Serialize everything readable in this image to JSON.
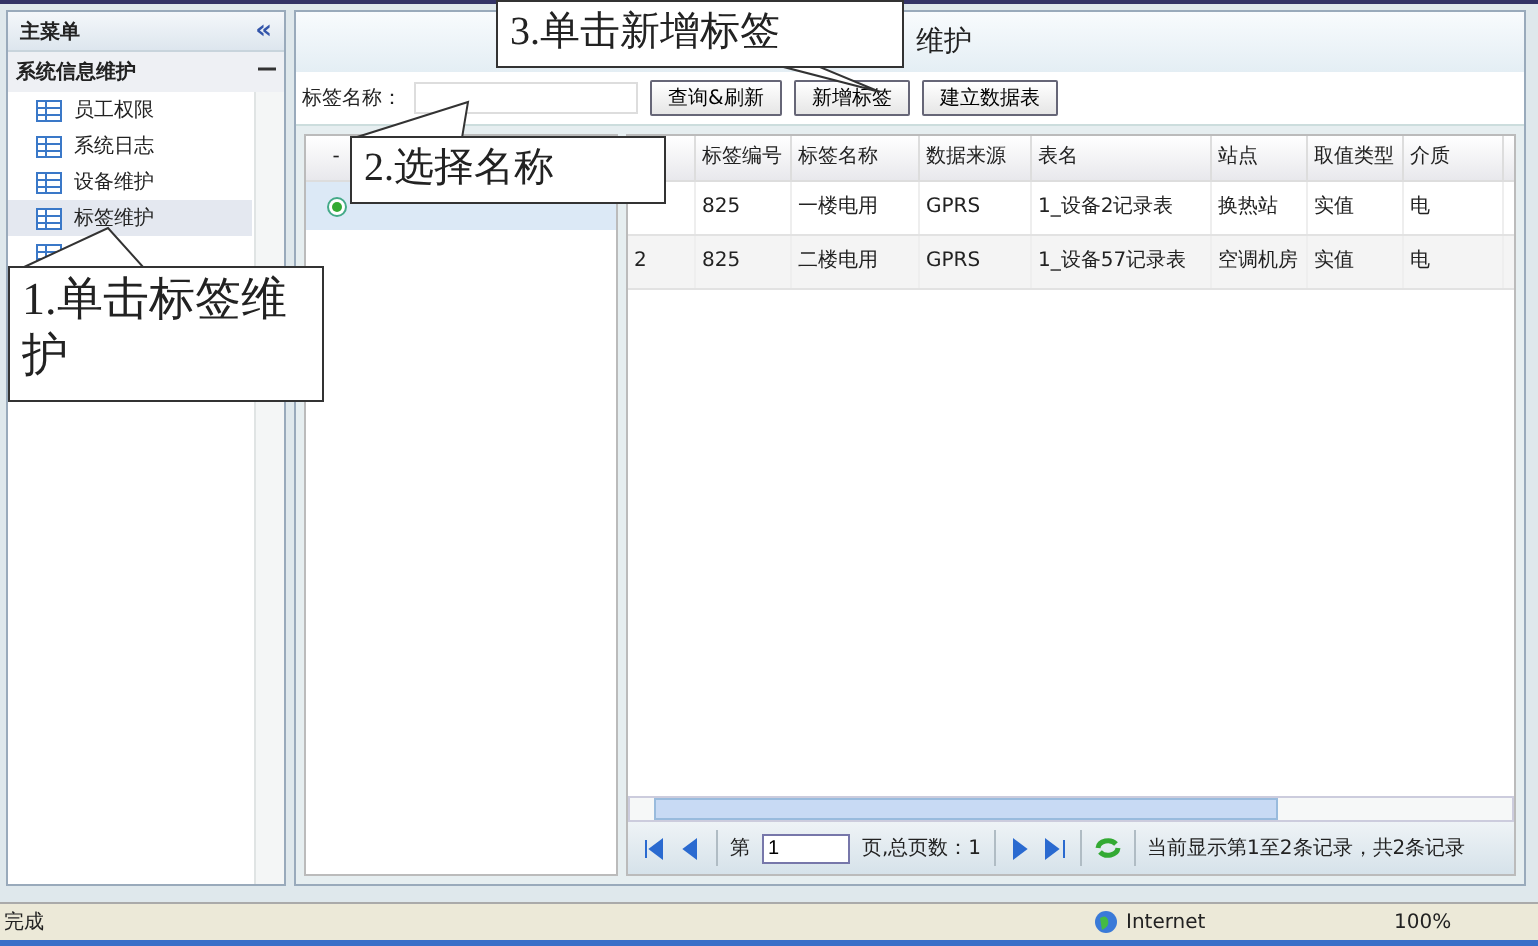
{
  "sidebar": {
    "title": "主菜单",
    "collapse_icon": "«",
    "group": {
      "title": "系统信息维护",
      "expanded": true,
      "items": [
        {
          "label": "员工权限",
          "selected": false
        },
        {
          "label": "系统日志",
          "selected": false
        },
        {
          "label": "设备维护",
          "selected": false
        },
        {
          "label": "标签维护",
          "selected": true
        },
        {
          "selected": false
        }
      ]
    }
  },
  "main": {
    "title": "维护",
    "filter": {
      "label": "标签名称："
    },
    "buttons": [
      "查询&刷新",
      "新增标签",
      "建立数据表"
    ],
    "left_grid": {
      "header": "-",
      "rows": [
        {
          "selected": true
        }
      ]
    },
    "table": {
      "columns": [
        "",
        "标签编号",
        "标签名称",
        "数据来源",
        "表名",
        "站点",
        "取值类型",
        "介质"
      ],
      "rows": [
        [
          "",
          "825",
          "一楼电用",
          "GPRS",
          "1_设备2记录表",
          "换热站",
          "实值",
          "电"
        ],
        [
          "2",
          "825",
          "二楼电用",
          "GPRS",
          "1_设备57记录表",
          "空调机房",
          "实值",
          "电"
        ]
      ]
    },
    "pager": {
      "page_prefix": "第",
      "page": "1",
      "total_pages": "页,总页数：1",
      "summary": "当前显示第1至2条记录，共2条记录"
    }
  },
  "callouts": [
    {
      "text": "1.单击标签维护"
    },
    {
      "text": "2.选择名称"
    },
    {
      "text": "3.单击新增标签"
    }
  ],
  "status_bar": {
    "text": "完成",
    "zone": "Internet",
    "zoom": "100%"
  }
}
